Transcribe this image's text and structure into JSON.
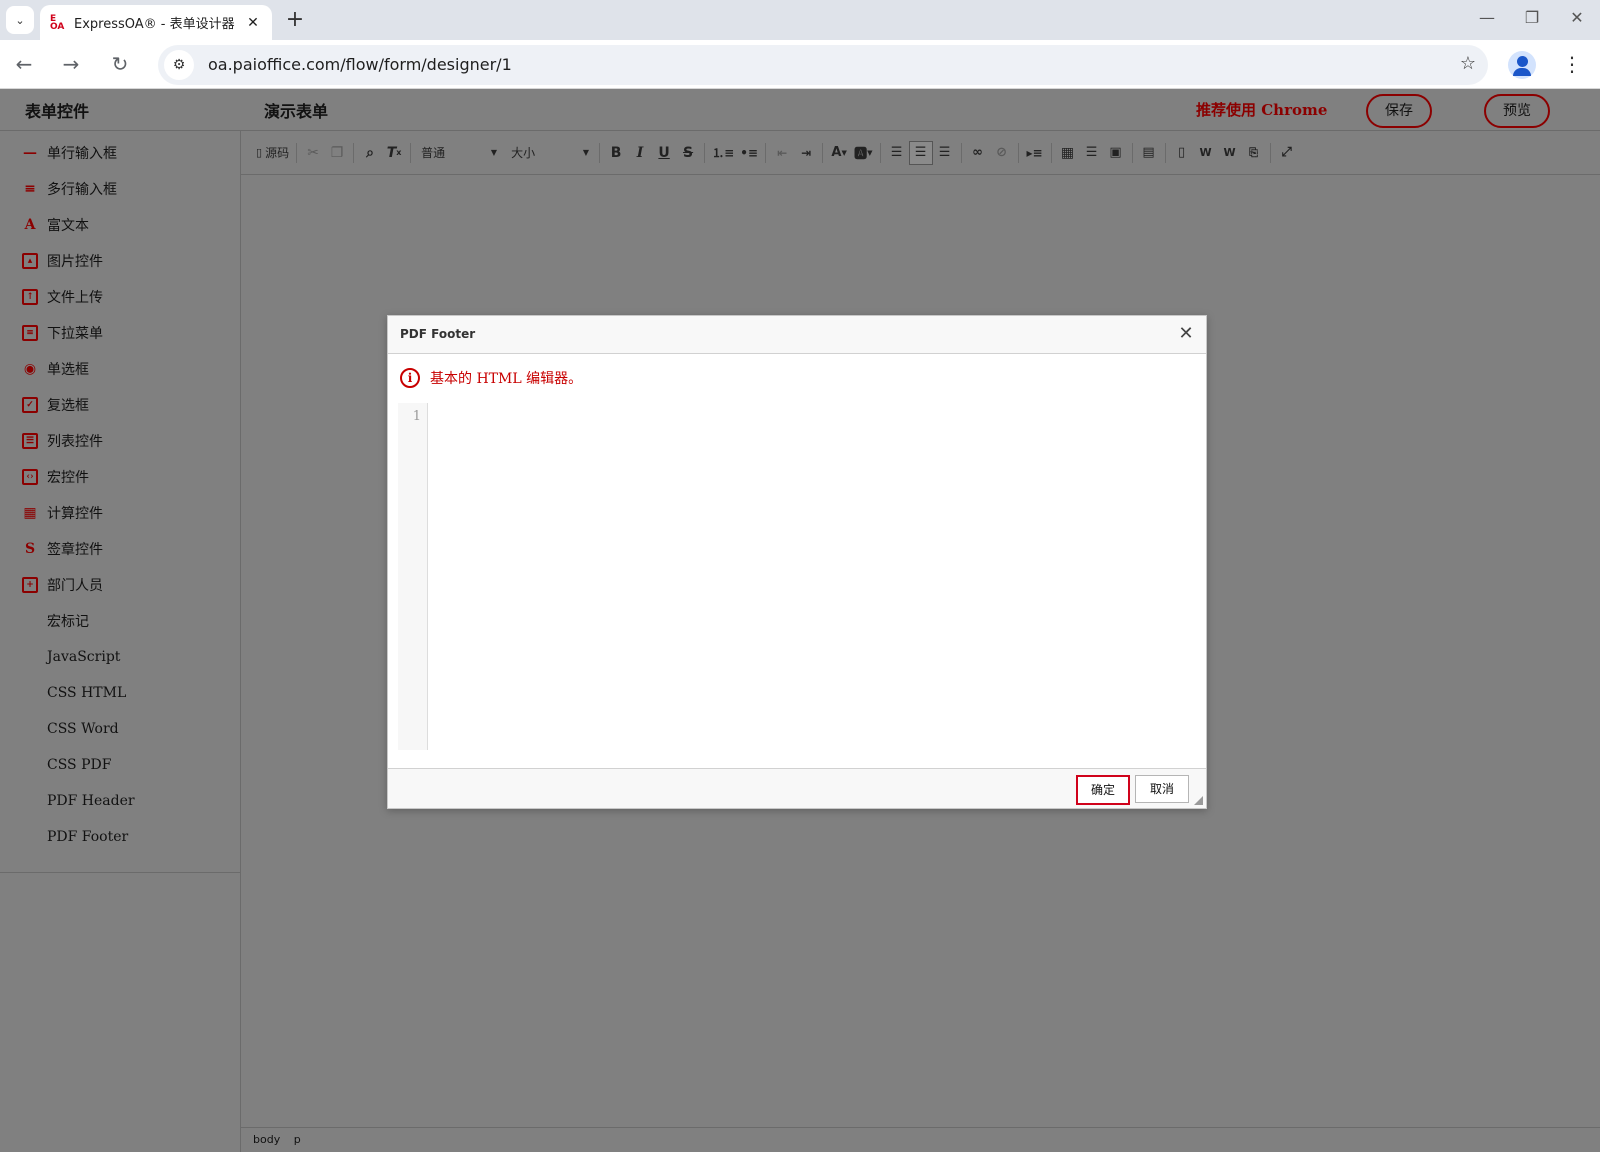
{
  "browser": {
    "tab_title": "ExpressOA® - 表单设计器",
    "tab_favicon": "E OA",
    "url": "oa.paioffice.com/flow/form/designer/1"
  },
  "header": {
    "panel_title": "表单控件",
    "form_name": "演示表单",
    "recommend": "推荐使用 Chrome",
    "save_label": "保存",
    "preview_label": "预览"
  },
  "sidebar": {
    "items": [
      {
        "label": "单行输入框",
        "icon": "single-line-icon"
      },
      {
        "label": "多行输入框",
        "icon": "multi-line-icon"
      },
      {
        "label": "富文本",
        "icon": "rich-text-icon"
      },
      {
        "label": "图片控件",
        "icon": "image-icon"
      },
      {
        "label": "文件上传",
        "icon": "file-upload-icon"
      },
      {
        "label": "下拉菜单",
        "icon": "dropdown-icon"
      },
      {
        "label": "单选框",
        "icon": "radio-icon"
      },
      {
        "label": "复选框",
        "icon": "checkbox-icon"
      },
      {
        "label": "列表控件",
        "icon": "list-icon"
      },
      {
        "label": "宏控件",
        "icon": "macro-icon"
      },
      {
        "label": "计算控件",
        "icon": "calculator-icon"
      },
      {
        "label": "签章控件",
        "icon": "signature-icon"
      },
      {
        "label": "部门人员",
        "icon": "department-icon"
      },
      {
        "label": "宏标记",
        "icon": ""
      },
      {
        "label": "JavaScript",
        "icon": ""
      },
      {
        "label": "CSS HTML",
        "icon": ""
      },
      {
        "label": "CSS Word",
        "icon": ""
      },
      {
        "label": "CSS PDF",
        "icon": ""
      },
      {
        "label": "PDF Header",
        "icon": ""
      },
      {
        "label": "PDF Footer",
        "icon": ""
      }
    ]
  },
  "toolbar": {
    "source_label": "源码",
    "format_value": "普通",
    "size_value": "大小"
  },
  "statusbar": {
    "path": [
      "body",
      "p"
    ]
  },
  "dialog": {
    "title": "PDF Footer",
    "note": "基本的 HTML 编辑器。",
    "line_number": "1",
    "ok_label": "确定",
    "cancel_label": "取消"
  },
  "colors": {
    "accent": "#8b0000",
    "overlay": "#808080",
    "dialog_note": "#c80000"
  }
}
